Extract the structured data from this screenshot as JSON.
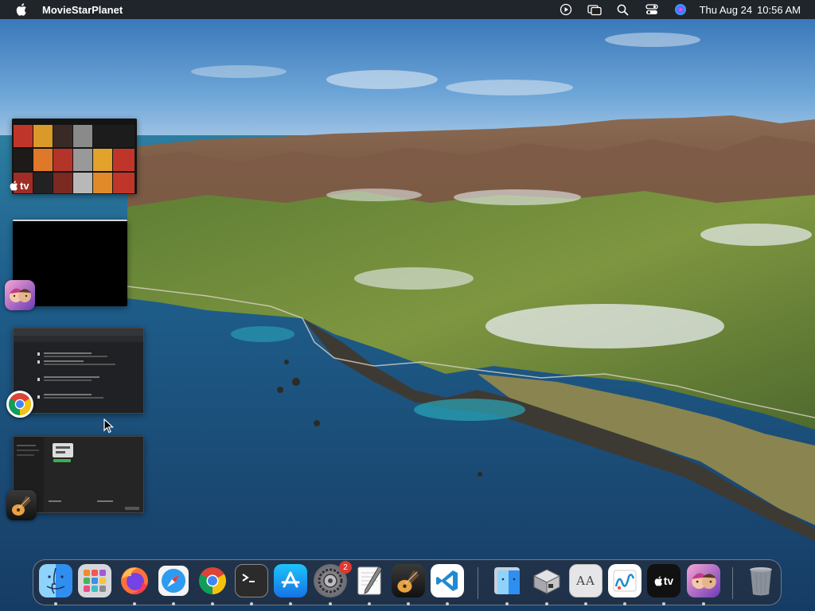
{
  "menubar": {
    "app_name": "MovieStarPlanet",
    "date": "Thu Aug 24",
    "time": "10:56 AM",
    "icons": [
      "apple-icon",
      "play-circle-icon",
      "screen-mirroring-icon",
      "spotlight-search-icon",
      "control-center-icon",
      "siri-icon"
    ]
  },
  "stage": {
    "tv_logo_text": "tv",
    "apps": [
      "Apple TV",
      "MovieStarPlanet",
      "Google Chrome",
      "GarageBand"
    ]
  },
  "dock": {
    "items": [
      {
        "name": "Finder",
        "icon": "finder-icon",
        "running": true
      },
      {
        "name": "Launchpad",
        "icon": "launchpad-icon",
        "running": false
      },
      {
        "name": "Firefox",
        "icon": "firefox-icon",
        "running": true
      },
      {
        "name": "Safari",
        "icon": "safari-icon",
        "running": true
      },
      {
        "name": "Google Chrome",
        "icon": "chrome-icon",
        "running": true
      },
      {
        "name": "Terminal",
        "icon": "terminal-icon",
        "running": true
      },
      {
        "name": "App Store",
        "icon": "app-store-icon",
        "running": true
      },
      {
        "name": "System Settings",
        "icon": "system-settings-icon",
        "running": true,
        "badge": "2"
      },
      {
        "name": "TextEdit",
        "icon": "textedit-icon",
        "running": true
      },
      {
        "name": "GarageBand",
        "icon": "garageband-icon",
        "running": true
      },
      {
        "name": "Visual Studio Code",
        "icon": "vscode-icon",
        "running": true
      },
      {
        "name": "Finder (recent)",
        "icon": "finder-recent-icon",
        "running": true
      },
      {
        "name": "Boot Camp Assistant",
        "icon": "bootcamp-icon",
        "running": true
      },
      {
        "name": "Font Book",
        "icon": "font-book-icon",
        "running": true
      },
      {
        "name": "Freeform",
        "icon": "freeform-icon",
        "running": true
      },
      {
        "name": "Apple TV",
        "icon": "apple-tv-icon",
        "running": true
      },
      {
        "name": "MovieStarPlanet",
        "icon": "moviestarplanet-icon",
        "running": true
      },
      {
        "name": "Trash",
        "icon": "trash-icon",
        "running": false
      }
    ],
    "tv_label": "tv",
    "fontbook_label": "AA"
  },
  "colors": {
    "menubar_bg": "#1e1e1e",
    "sea": "#1d4f7c",
    "badge": "#e0382f"
  }
}
